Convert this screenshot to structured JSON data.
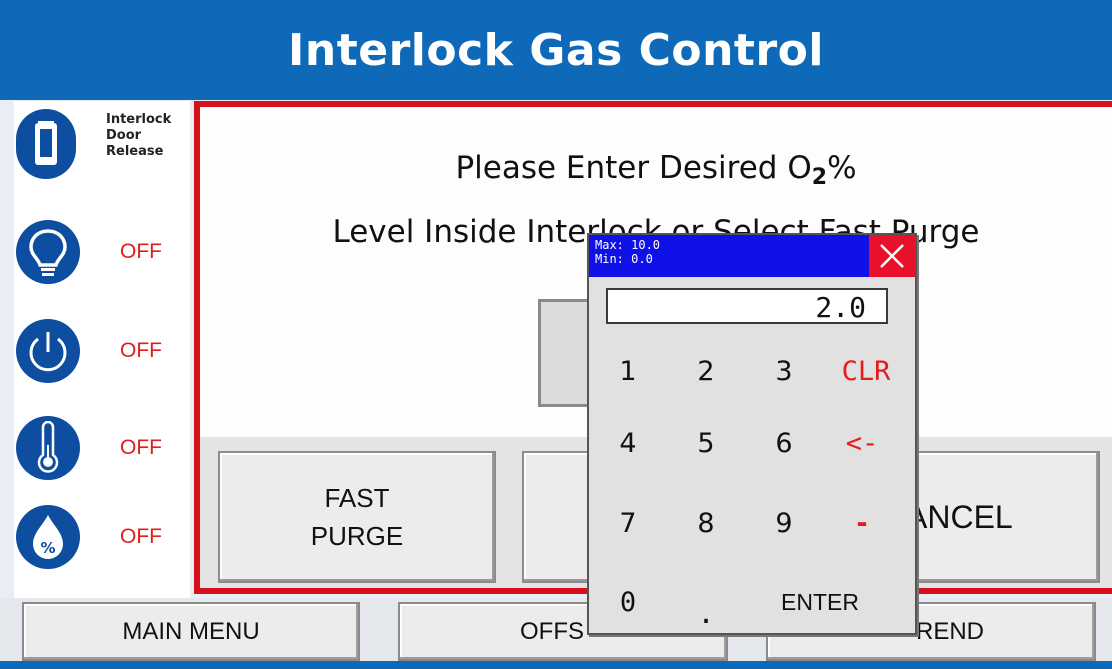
{
  "header": {
    "title": "Interlock Gas Control"
  },
  "sidebar": {
    "door": {
      "label_lines": [
        "Interlock",
        "Door",
        "Release"
      ],
      "icon": "door-release-icon"
    },
    "items": [
      {
        "icon": "lightbulb-icon",
        "status": "OFF"
      },
      {
        "icon": "power-icon",
        "status": "OFF"
      },
      {
        "icon": "thermometer-icon",
        "status": "OFF"
      },
      {
        "icon": "percent-drop-icon",
        "status": "OFF"
      }
    ]
  },
  "prompt": {
    "line1_prefix": "Please Enter Desired O",
    "line1_sub": "2",
    "line1_suffix": "%",
    "line2": "Level Inside Interlock or Select Fast Purge"
  },
  "buttons": {
    "fast_purge_line1": "FAST",
    "fast_purge_line2": "PURGE",
    "cancel": "ANCEL"
  },
  "keypad": {
    "max": "Max: 10.0",
    "min": "Min: 0.0",
    "display": "2.0",
    "keys": [
      "1",
      "2",
      "3",
      "CLR",
      "4",
      "5",
      "6",
      "<-",
      "7",
      "8",
      "9",
      "-",
      "0",
      ".",
      "ENTER"
    ]
  },
  "footer": {
    "main_menu": "MAIN MENU",
    "offset": "OFFS",
    "trend": "REND"
  },
  "colors": {
    "header_blue": "#0e6ab8",
    "status_red": "#e01e1e",
    "panel_border": "#d6101c",
    "keypad_title": "#1010e8",
    "close_red": "#e8102a"
  }
}
